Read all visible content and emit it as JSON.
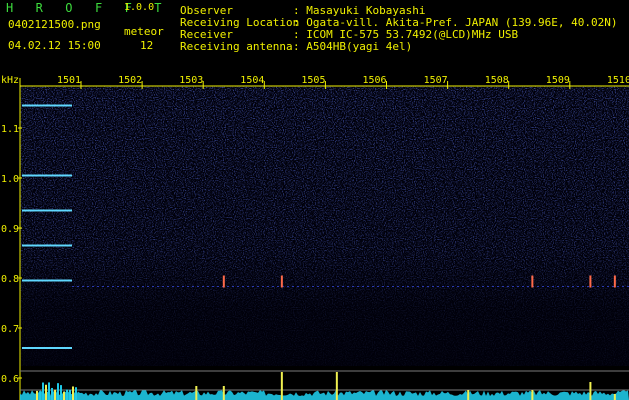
{
  "app": {
    "title": "H R O F F T",
    "version": "1.0.0"
  },
  "file": {
    "name": "0402121500.png",
    "datetime": "04.02.12 15:00"
  },
  "counter": {
    "label": "meteor",
    "value": "12"
  },
  "info": [
    {
      "label": "Observer",
      "value": ": Masayuki Kobayashi"
    },
    {
      "label": "Receiving Location",
      "value": ": Ogata-vill. Akita-Pref. JAPAN (139.96E, 40.02N)"
    },
    {
      "label": "Receiver",
      "value": ": ICOM IC-575 53.7492(@LCD)MHz USB"
    },
    {
      "label": "Receiving antenna",
      "value": ": A504HB(yagi 4el)"
    }
  ],
  "colors": {
    "header_green": "#3ddc3d",
    "header_yellow": "#f0f000",
    "background": "#000000",
    "spectrum_blue": "#1e2ca8",
    "level_cyan": "#1ec8e6",
    "peak_yellow": "#f0f050"
  },
  "chart_data": {
    "type": "heatmap",
    "ylabel": "kHz",
    "y_ticks": [
      "1.1",
      "1.0",
      "0.9",
      "0.8",
      "0.7",
      "0.6"
    ],
    "x_ticks": [
      "1501",
      "1502",
      "1503",
      "1504",
      "1505",
      "1506",
      "1507",
      "1508",
      "1509",
      "1510"
    ],
    "carrier_lines_khz": [
      1.145,
      1.005,
      0.935,
      0.865,
      0.795,
      0.66
    ],
    "meteor_echo_minutes": [
      1503.55,
      1504.5,
      1508.6,
      1509.55,
      1509.95
    ]
  }
}
